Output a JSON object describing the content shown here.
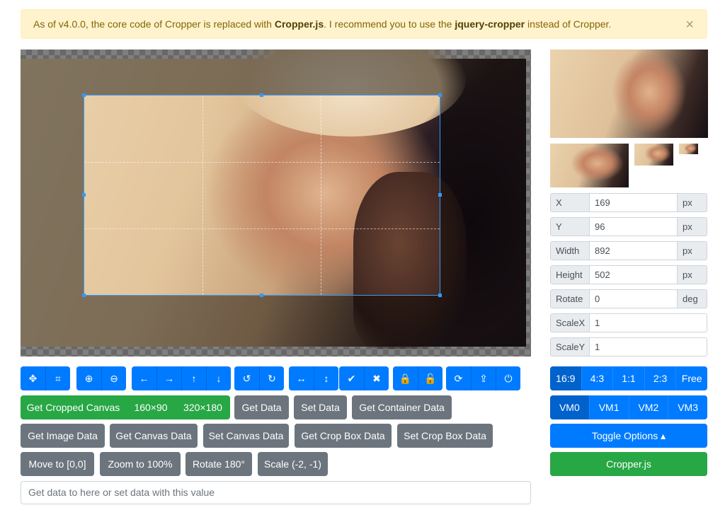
{
  "alert": {
    "prefix": "As of v4.0.0, the core code of Cropper is replaced with ",
    "lib": "Cropper.js",
    "middle": ". I recommend you to use the ",
    "plugin": "jquery-cropper",
    "suffix": " instead of Cropper.",
    "close": "×"
  },
  "toolbar": {
    "move": "✥",
    "crop": "⌗",
    "zoom_in": "⊕",
    "zoom_out": "⊖",
    "left": "←",
    "right": "→",
    "up": "↑",
    "down": "↓",
    "rotate_left": "↺",
    "rotate_right": "↻",
    "flip_h": "↔",
    "flip_v": "↕",
    "check": "✔",
    "cross": "✖",
    "lock": "🔒",
    "unlock": "🔓",
    "reset": "⟳",
    "upload": "⇪",
    "destroy": "⏻"
  },
  "buttons": {
    "get_cropped_canvas": "Get Cropped Canvas",
    "size_160": "160×90",
    "size_320": "320×180",
    "get_data": "Get Data",
    "set_data": "Set Data",
    "get_container_data": "Get Container Data",
    "get_image_data": "Get Image Data",
    "get_canvas_data": "Get Canvas Data",
    "set_canvas_data": "Set Canvas Data",
    "get_crop_box_data": "Get Crop Box Data",
    "set_crop_box_data": "Set Crop Box Data",
    "move_to": "Move to [0,0]",
    "zoom_to": "Zoom to 100%",
    "rotate_180": "Rotate 180°",
    "scale": "Scale (-2, -1)"
  },
  "data_input": {
    "placeholder": "Get data to here or set data with this value"
  },
  "fields": {
    "x": {
      "label": "X",
      "value": "169",
      "unit": "px"
    },
    "y": {
      "label": "Y",
      "value": "96",
      "unit": "px"
    },
    "width": {
      "label": "Width",
      "value": "892",
      "unit": "px"
    },
    "height": {
      "label": "Height",
      "value": "502",
      "unit": "px"
    },
    "rotate": {
      "label": "Rotate",
      "value": "0",
      "unit": "deg"
    },
    "scalex": {
      "label": "ScaleX",
      "value": "1"
    },
    "scaley": {
      "label": "ScaleY",
      "value": "1"
    }
  },
  "aspect_ratios": [
    "16:9",
    "4:3",
    "1:1",
    "2:3",
    "Free"
  ],
  "view_modes": [
    "VM0",
    "VM1",
    "VM2",
    "VM3"
  ],
  "toggle_options": "Toggle Options ▴",
  "cropperjs_link": "Cropper.js",
  "colors": {
    "primary": "#007bff",
    "secondary": "#6c757d",
    "success": "#28a745",
    "warning_bg": "#fff3cd"
  }
}
